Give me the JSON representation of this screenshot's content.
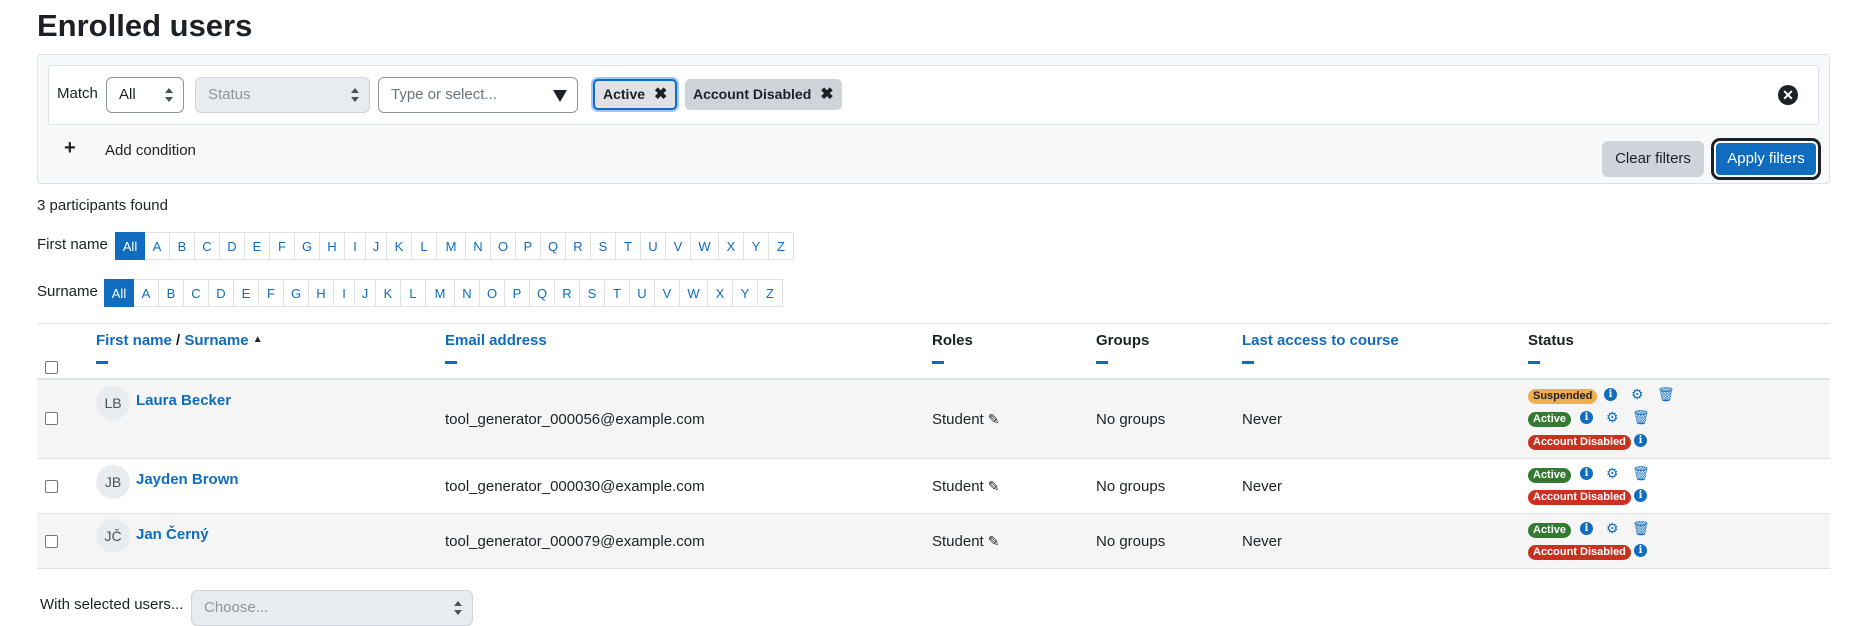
{
  "page_title": "Enrolled users",
  "filter": {
    "match_label": "Match",
    "match_value": "All",
    "status_placeholder": "Status",
    "type_placeholder": "Type or select...",
    "chips": [
      "Active",
      "Account Disabled"
    ],
    "add_condition_label": "Add condition",
    "clear_label": "Clear filters",
    "apply_label": "Apply filters"
  },
  "participants_found": "3 participants found",
  "initials_bar": {
    "first_name_label": "First name",
    "surname_label": "Surname",
    "all_label": "All",
    "letters": [
      "A",
      "B",
      "C",
      "D",
      "E",
      "F",
      "G",
      "H",
      "I",
      "J",
      "K",
      "L",
      "M",
      "N",
      "O",
      "P",
      "Q",
      "R",
      "S",
      "T",
      "U",
      "V",
      "W",
      "X",
      "Y",
      "Z"
    ]
  },
  "table": {
    "headers": {
      "first_name": "First name",
      "sep": "/",
      "surname": "Surname",
      "email": "Email address",
      "roles": "Roles",
      "groups": "Groups",
      "last_access": "Last access to course",
      "status": "Status"
    },
    "rows": [
      {
        "initials": "LB",
        "name": "Laura Becker",
        "email": "tool_generator_000056@example.com",
        "role": "Student",
        "groups": "No groups",
        "last_access": "Never",
        "statuses": [
          "Suspended",
          "Active",
          "Account Disabled"
        ]
      },
      {
        "initials": "JB",
        "name": "Jayden Brown",
        "email": "tool_generator_000030@example.com",
        "role": "Student",
        "groups": "No groups",
        "last_access": "Never",
        "statuses": [
          "Active",
          "Account Disabled"
        ]
      },
      {
        "initials": "JČ",
        "name": "Jan Černý",
        "email": "tool_generator_000079@example.com",
        "role": "Student",
        "groups": "No groups",
        "last_access": "Never",
        "statuses": [
          "Active",
          "Account Disabled"
        ]
      }
    ]
  },
  "bulk": {
    "label": "With selected users...",
    "placeholder": "Choose..."
  },
  "colors": {
    "accent": "#0f6cbf",
    "active": "#357a32",
    "disabled": "#ca3120",
    "suspended": "#f0ad4e"
  }
}
